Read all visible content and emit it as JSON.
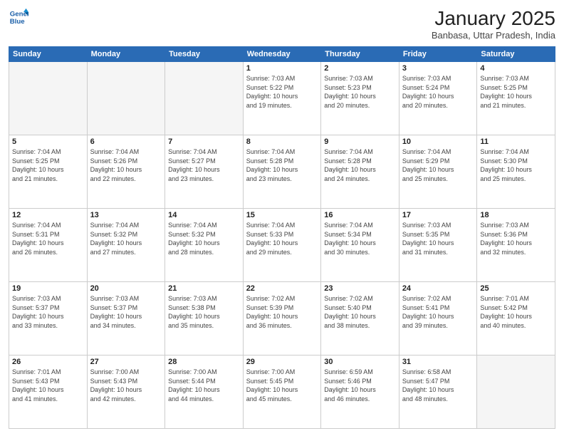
{
  "header": {
    "logo_line1": "General",
    "logo_line2": "Blue",
    "title": "January 2025",
    "subtitle": "Banbasa, Uttar Pradesh, India"
  },
  "days_of_week": [
    "Sunday",
    "Monday",
    "Tuesday",
    "Wednesday",
    "Thursday",
    "Friday",
    "Saturday"
  ],
  "weeks": [
    [
      {
        "day": "",
        "info": ""
      },
      {
        "day": "",
        "info": ""
      },
      {
        "day": "",
        "info": ""
      },
      {
        "day": "1",
        "info": "Sunrise: 7:03 AM\nSunset: 5:22 PM\nDaylight: 10 hours\nand 19 minutes."
      },
      {
        "day": "2",
        "info": "Sunrise: 7:03 AM\nSunset: 5:23 PM\nDaylight: 10 hours\nand 20 minutes."
      },
      {
        "day": "3",
        "info": "Sunrise: 7:03 AM\nSunset: 5:24 PM\nDaylight: 10 hours\nand 20 minutes."
      },
      {
        "day": "4",
        "info": "Sunrise: 7:03 AM\nSunset: 5:25 PM\nDaylight: 10 hours\nand 21 minutes."
      }
    ],
    [
      {
        "day": "5",
        "info": "Sunrise: 7:04 AM\nSunset: 5:25 PM\nDaylight: 10 hours\nand 21 minutes."
      },
      {
        "day": "6",
        "info": "Sunrise: 7:04 AM\nSunset: 5:26 PM\nDaylight: 10 hours\nand 22 minutes."
      },
      {
        "day": "7",
        "info": "Sunrise: 7:04 AM\nSunset: 5:27 PM\nDaylight: 10 hours\nand 23 minutes."
      },
      {
        "day": "8",
        "info": "Sunrise: 7:04 AM\nSunset: 5:28 PM\nDaylight: 10 hours\nand 23 minutes."
      },
      {
        "day": "9",
        "info": "Sunrise: 7:04 AM\nSunset: 5:28 PM\nDaylight: 10 hours\nand 24 minutes."
      },
      {
        "day": "10",
        "info": "Sunrise: 7:04 AM\nSunset: 5:29 PM\nDaylight: 10 hours\nand 25 minutes."
      },
      {
        "day": "11",
        "info": "Sunrise: 7:04 AM\nSunset: 5:30 PM\nDaylight: 10 hours\nand 25 minutes."
      }
    ],
    [
      {
        "day": "12",
        "info": "Sunrise: 7:04 AM\nSunset: 5:31 PM\nDaylight: 10 hours\nand 26 minutes."
      },
      {
        "day": "13",
        "info": "Sunrise: 7:04 AM\nSunset: 5:32 PM\nDaylight: 10 hours\nand 27 minutes."
      },
      {
        "day": "14",
        "info": "Sunrise: 7:04 AM\nSunset: 5:32 PM\nDaylight: 10 hours\nand 28 minutes."
      },
      {
        "day": "15",
        "info": "Sunrise: 7:04 AM\nSunset: 5:33 PM\nDaylight: 10 hours\nand 29 minutes."
      },
      {
        "day": "16",
        "info": "Sunrise: 7:04 AM\nSunset: 5:34 PM\nDaylight: 10 hours\nand 30 minutes."
      },
      {
        "day": "17",
        "info": "Sunrise: 7:03 AM\nSunset: 5:35 PM\nDaylight: 10 hours\nand 31 minutes."
      },
      {
        "day": "18",
        "info": "Sunrise: 7:03 AM\nSunset: 5:36 PM\nDaylight: 10 hours\nand 32 minutes."
      }
    ],
    [
      {
        "day": "19",
        "info": "Sunrise: 7:03 AM\nSunset: 5:37 PM\nDaylight: 10 hours\nand 33 minutes."
      },
      {
        "day": "20",
        "info": "Sunrise: 7:03 AM\nSunset: 5:37 PM\nDaylight: 10 hours\nand 34 minutes."
      },
      {
        "day": "21",
        "info": "Sunrise: 7:03 AM\nSunset: 5:38 PM\nDaylight: 10 hours\nand 35 minutes."
      },
      {
        "day": "22",
        "info": "Sunrise: 7:02 AM\nSunset: 5:39 PM\nDaylight: 10 hours\nand 36 minutes."
      },
      {
        "day": "23",
        "info": "Sunrise: 7:02 AM\nSunset: 5:40 PM\nDaylight: 10 hours\nand 38 minutes."
      },
      {
        "day": "24",
        "info": "Sunrise: 7:02 AM\nSunset: 5:41 PM\nDaylight: 10 hours\nand 39 minutes."
      },
      {
        "day": "25",
        "info": "Sunrise: 7:01 AM\nSunset: 5:42 PM\nDaylight: 10 hours\nand 40 minutes."
      }
    ],
    [
      {
        "day": "26",
        "info": "Sunrise: 7:01 AM\nSunset: 5:43 PM\nDaylight: 10 hours\nand 41 minutes."
      },
      {
        "day": "27",
        "info": "Sunrise: 7:00 AM\nSunset: 5:43 PM\nDaylight: 10 hours\nand 42 minutes."
      },
      {
        "day": "28",
        "info": "Sunrise: 7:00 AM\nSunset: 5:44 PM\nDaylight: 10 hours\nand 44 minutes."
      },
      {
        "day": "29",
        "info": "Sunrise: 7:00 AM\nSunset: 5:45 PM\nDaylight: 10 hours\nand 45 minutes."
      },
      {
        "day": "30",
        "info": "Sunrise: 6:59 AM\nSunset: 5:46 PM\nDaylight: 10 hours\nand 46 minutes."
      },
      {
        "day": "31",
        "info": "Sunrise: 6:58 AM\nSunset: 5:47 PM\nDaylight: 10 hours\nand 48 minutes."
      },
      {
        "day": "",
        "info": ""
      }
    ]
  ]
}
